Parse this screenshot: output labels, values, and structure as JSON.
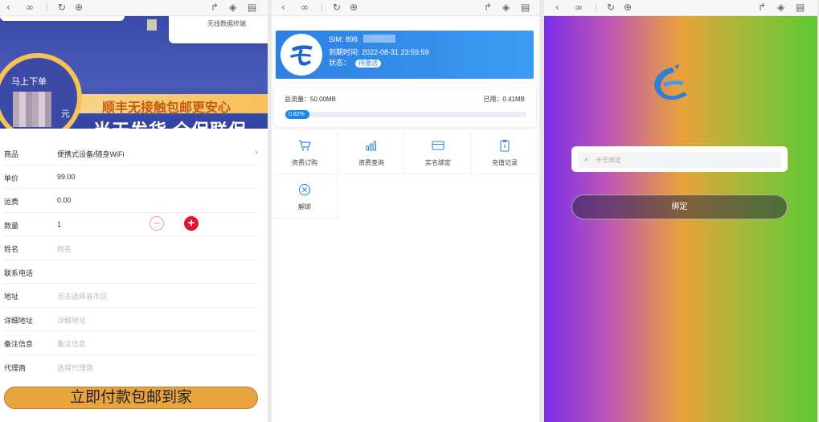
{
  "toolbar": {
    "icons": [
      "back-icon",
      "link-icon",
      "refresh-icon",
      "globe-icon",
      "share-icon",
      "cube-icon",
      "bookmark-icon"
    ]
  },
  "order": {
    "device_card_label": "无线数据终端",
    "price_title": "马上下单",
    "yuan": "元",
    "strip_text": "顺丰无接触包邮更安心",
    "big_text": "当天发货 全保联保",
    "fields": [
      {
        "label": "商品",
        "value": "便携式设备/随身WiFi"
      },
      {
        "label": "单价",
        "value": "99.00"
      },
      {
        "label": "运费",
        "value": "0.00"
      },
      {
        "label": "数量",
        "value": "1"
      },
      {
        "label": "姓名",
        "placeholder": "姓名"
      },
      {
        "label": "联系电话",
        "placeholder": ""
      },
      {
        "label": "地址",
        "placeholder": "点击选择省市区"
      },
      {
        "label": "详细地址",
        "placeholder": "详细地址"
      },
      {
        "label": "备注信息",
        "placeholder": "备注信息"
      },
      {
        "label": "代理商",
        "placeholder": "选择代理商"
      }
    ],
    "pay_button": "立即付款包邮到家"
  },
  "sim": {
    "sim_label": "SIM: 898",
    "expire": "到期时间: 2022-08-31 23:59:59",
    "status_label": "状态：",
    "status_badge": "待激活",
    "total": "总流量：50.00MB",
    "used": "已用：0.41MB",
    "percent": "0.82%",
    "percent_value": 0.0082,
    "menu": [
      {
        "label": "资费订购",
        "icon": "cart-icon"
      },
      {
        "label": "资费查询",
        "icon": "bar-chart-icon"
      },
      {
        "label": "实名绑定",
        "icon": "card-icon"
      },
      {
        "label": "充值记录",
        "icon": "clipboard-icon"
      },
      {
        "label": "解绑",
        "icon": "close-circle-icon"
      }
    ]
  },
  "bind": {
    "placeholder": "卡号绑定",
    "button": "绑定"
  }
}
